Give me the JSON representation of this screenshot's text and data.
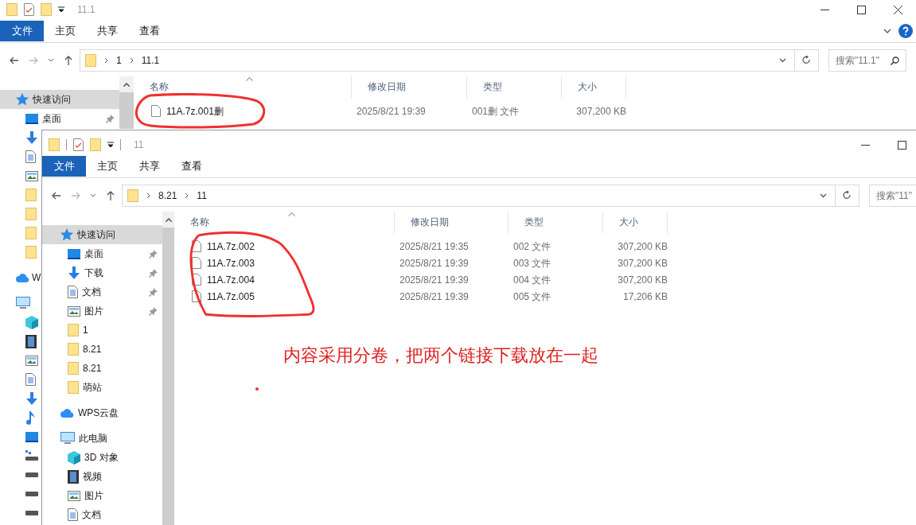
{
  "windows": [
    {
      "title": "11.1",
      "ribbon_tabs": [
        {
          "label": "文件",
          "selected": true
        },
        {
          "label": "主页",
          "selected": false
        },
        {
          "label": "共享",
          "selected": false
        },
        {
          "label": "查看",
          "selected": false
        }
      ],
      "address": {
        "path": [
          "1",
          "11.1"
        ]
      },
      "search": {
        "placeholder": "搜索\"11.1\""
      },
      "columns": [
        "名称",
        "修改日期",
        "类型",
        "大小"
      ],
      "files": [
        {
          "name": "11A.7z.001删",
          "modified": "2025/8/21 19:39",
          "type": "001删 文件",
          "size": "307,200 KB"
        }
      ],
      "sidebar": [
        {
          "kind": "star",
          "label": "快速访问",
          "selected": true,
          "children": [
            {
              "kind": "desktop",
              "label": "桌面",
              "pinned": true,
              "selected": false
            },
            {
              "kind": "download",
              "selected": false
            },
            {
              "kind": "doc",
              "selected": false
            },
            {
              "kind": "picture",
              "selected": false
            },
            {
              "kind": "folder",
              "selected": false
            },
            {
              "kind": "folder",
              "selected": false
            },
            {
              "kind": "folder",
              "selected": false
            },
            {
              "kind": "folder",
              "selected": false
            }
          ]
        },
        {
          "kind": "cloud",
          "label": "W",
          "selected": false
        },
        {
          "kind": "pc",
          "selected": false,
          "children": [
            {
              "kind": "cube",
              "selected": false
            },
            {
              "kind": "film",
              "selected": false
            },
            {
              "kind": "picture",
              "selected": false
            },
            {
              "kind": "doc",
              "selected": false
            },
            {
              "kind": "download",
              "selected": false
            },
            {
              "kind": "music",
              "selected": false
            },
            {
              "kind": "desktop",
              "selected": false
            },
            {
              "kind": "netdrive",
              "selected": false
            },
            {
              "kind": "drive",
              "selected": false
            },
            {
              "kind": "drive",
              "selected": false
            },
            {
              "kind": "drive",
              "selected": false
            }
          ]
        }
      ]
    },
    {
      "title": "11",
      "ribbon_tabs": [
        {
          "label": "文件",
          "selected": true
        },
        {
          "label": "主页",
          "selected": false
        },
        {
          "label": "共享",
          "selected": false
        },
        {
          "label": "查看",
          "selected": false
        }
      ],
      "address": {
        "path": [
          "8.21",
          "11"
        ]
      },
      "search": {
        "placeholder": "搜索\"11\""
      },
      "columns": [
        "名称",
        "修改日期",
        "类型",
        "大小"
      ],
      "files": [
        {
          "name": "11A.7z.002",
          "modified": "2025/8/21 19:35",
          "type": "002 文件",
          "size": "307,200 KB"
        },
        {
          "name": "11A.7z.003",
          "modified": "2025/8/21 19:39",
          "type": "003 文件",
          "size": "307,200 KB"
        },
        {
          "name": "11A.7z.004",
          "modified": "2025/8/21 19:39",
          "type": "004 文件",
          "size": "307,200 KB"
        },
        {
          "name": "11A.7z.005",
          "modified": "2025/8/21 19:39",
          "type": "005 文件",
          "size": "17,206 KB"
        }
      ],
      "sidebar": [
        {
          "kind": "star",
          "label": "快速访问",
          "selected": true,
          "children": [
            {
              "kind": "desktop",
              "label": "桌面",
              "pinned": true,
              "selected": false
            },
            {
              "kind": "download",
              "label": "下载",
              "pinned": true,
              "selected": false
            },
            {
              "kind": "doc",
              "label": "文档",
              "pinned": true,
              "selected": false
            },
            {
              "kind": "picture",
              "label": "图片",
              "pinned": true,
              "selected": false
            },
            {
              "kind": "folder",
              "label": "1",
              "pinned": false,
              "selected": false
            },
            {
              "kind": "folder",
              "label": "8.21",
              "pinned": false,
              "selected": false
            },
            {
              "kind": "folder",
              "label": "8.21",
              "pinned": false,
              "selected": false
            },
            {
              "kind": "folder",
              "label": "萌站",
              "pinned": false,
              "selected": false
            }
          ]
        },
        {
          "kind": "cloud",
          "label": "WPS云盘",
          "selected": false
        },
        {
          "kind": "pc",
          "label": "此电脑",
          "selected": false,
          "children": [
            {
              "kind": "cube",
              "label": "3D 对象",
              "selected": false
            },
            {
              "kind": "film",
              "label": "视频",
              "selected": false
            },
            {
              "kind": "picture",
              "label": "图片",
              "selected": false
            },
            {
              "kind": "doc",
              "label": "文档",
              "selected": false
            }
          ]
        }
      ]
    }
  ],
  "annotation": {
    "note": "内容采用分卷，把两个链接下载放在一起"
  }
}
